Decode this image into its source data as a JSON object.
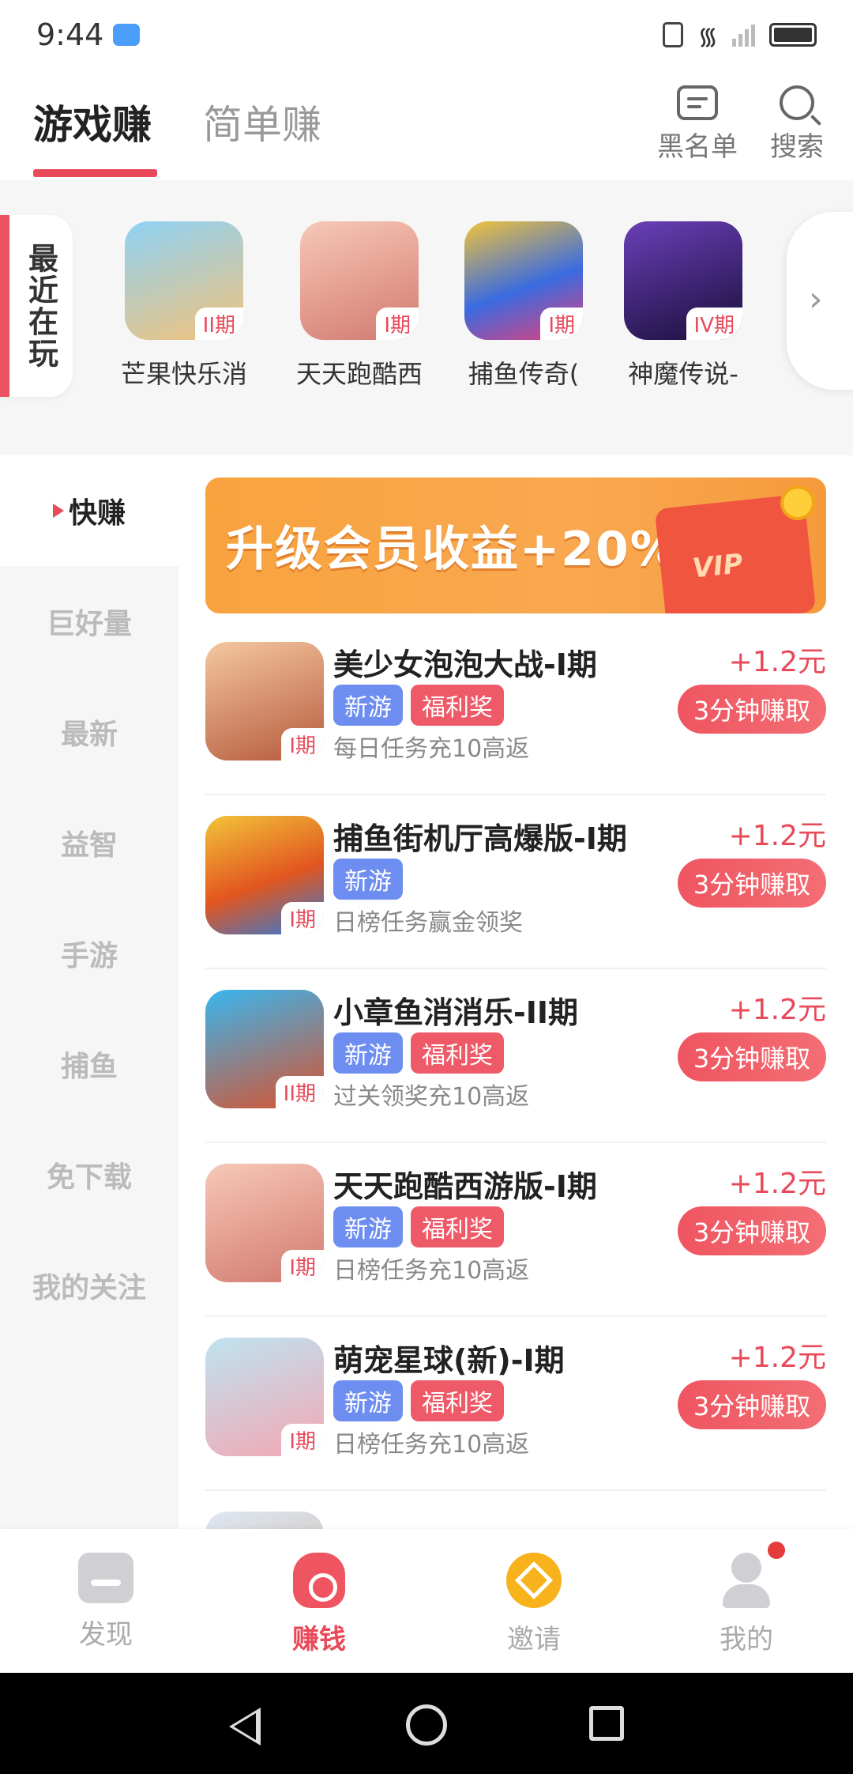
{
  "status_bar": {
    "time": "9:44"
  },
  "header": {
    "tabs": [
      {
        "label": "游戏赚"
      },
      {
        "label": "简单赚"
      }
    ],
    "actions": {
      "blacklist": "黑名单",
      "search": "搜索"
    }
  },
  "recent": {
    "label": "最近在玩",
    "items": [
      {
        "title": "芒果快乐消",
        "period": "II期",
        "color": "#7fc6f0"
      },
      {
        "title": "天天跑酷西",
        "period": "I期",
        "color": "#f1a5a0"
      },
      {
        "title": "捕鱼传奇(",
        "period": "I期",
        "color": "#3a6be0"
      },
      {
        "title": "神魔传说-",
        "period": "IV期",
        "color": "#2a1a5a"
      }
    ]
  },
  "sidebar": {
    "items": [
      {
        "label": "快赚"
      },
      {
        "label": "巨好量"
      },
      {
        "label": "最新"
      },
      {
        "label": "益智"
      },
      {
        "label": "手游"
      },
      {
        "label": "捕鱼"
      },
      {
        "label": "免下载"
      },
      {
        "label": "我的关注"
      }
    ]
  },
  "banner": {
    "text": "升级会员收益+20%",
    "tag": "VIP"
  },
  "games": [
    {
      "name": "美少女泡泡大战-I期",
      "tags": [
        "新游",
        "福利奖"
      ],
      "desc": "每日任务充10高返",
      "reward": "+1.2元",
      "button": "3分钟赚取",
      "period": "I期",
      "color": "#e7a47a"
    },
    {
      "name": "捕鱼街机厅高爆版-I期",
      "tags": [
        "新游"
      ],
      "desc": "日榜任务赢金领奖",
      "reward": "+1.2元",
      "button": "3分钟赚取",
      "period": "I期",
      "color": "#e2561f"
    },
    {
      "name": "小章鱼消消乐-II期",
      "tags": [
        "新游",
        "福利奖"
      ],
      "desc": "过关领奖充10高返",
      "reward": "+1.2元",
      "button": "3分钟赚取",
      "period": "II期",
      "color": "#2f9be0"
    },
    {
      "name": "天天跑酷西游版-I期",
      "tags": [
        "新游",
        "福利奖"
      ],
      "desc": "日榜任务充10高返",
      "reward": "+1.2元",
      "button": "3分钟赚取",
      "period": "I期",
      "color": "#f1a5a0"
    },
    {
      "name": "萌宠星球(新)-I期",
      "tags": [
        "新游",
        "福利奖"
      ],
      "desc": "日榜任务充10高返",
      "reward": "+1.2元",
      "button": "3分钟赚取",
      "period": "I期",
      "color": "#a8d6e8"
    }
  ],
  "bottom_nav": [
    {
      "label": "发现"
    },
    {
      "label": "赚钱"
    },
    {
      "label": "邀请"
    },
    {
      "label": "我的"
    }
  ],
  "colors": {
    "accent": "#e84a5a",
    "tag_new": "#6d8ef0",
    "tag_welfare": "#ef5a68",
    "banner": "#f8a33e"
  }
}
